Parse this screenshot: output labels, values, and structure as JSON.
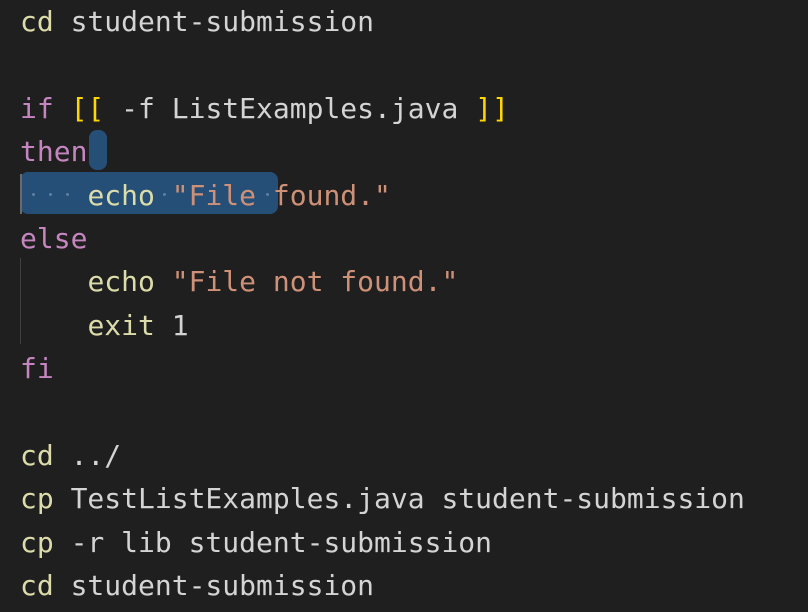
{
  "editor": {
    "lines": [
      {
        "tokens": [
          {
            "t": "cd",
            "c": "kw-cmd"
          },
          {
            "t": " student-submission",
            "c": "plain"
          }
        ]
      },
      {
        "tokens": []
      },
      {
        "tokens": [
          {
            "t": "if",
            "c": "kw-ctl"
          },
          {
            "t": " ",
            "c": "plain"
          },
          {
            "t": "[[",
            "c": "br1"
          },
          {
            "t": " -f ListExamples.java ",
            "c": "plain"
          },
          {
            "t": "]]",
            "c": "br1"
          }
        ]
      },
      {
        "tokens": [
          {
            "t": "then",
            "c": "kw-ctl"
          }
        ]
      },
      {
        "tokens": [
          {
            "t": "    ",
            "c": "plain"
          },
          {
            "t": "echo",
            "c": "kw-cmd"
          },
          {
            "t": " ",
            "c": "plain"
          },
          {
            "t": "\"File found.\"",
            "c": "str"
          }
        ]
      },
      {
        "tokens": [
          {
            "t": "else",
            "c": "kw-ctl"
          }
        ]
      },
      {
        "tokens": [
          {
            "t": "    ",
            "c": "plain"
          },
          {
            "t": "echo",
            "c": "kw-cmd"
          },
          {
            "t": " ",
            "c": "plain"
          },
          {
            "t": "\"File not found.\"",
            "c": "str"
          }
        ]
      },
      {
        "tokens": [
          {
            "t": "    ",
            "c": "plain"
          },
          {
            "t": "exit",
            "c": "kw-cmd"
          },
          {
            "t": " 1",
            "c": "num"
          }
        ]
      },
      {
        "tokens": [
          {
            "t": "fi",
            "c": "kw-ctl"
          }
        ]
      },
      {
        "tokens": []
      },
      {
        "tokens": [
          {
            "t": "cd",
            "c": "kw-cmd"
          },
          {
            "t": " ../",
            "c": "plain"
          }
        ]
      },
      {
        "tokens": [
          {
            "t": "cp",
            "c": "kw-cmd"
          },
          {
            "t": " TestListExamples.java student-submission",
            "c": "plain"
          }
        ]
      },
      {
        "tokens": [
          {
            "t": "cp",
            "c": "kw-cmd"
          },
          {
            "t": " -r lib student-submission",
            "c": "plain"
          }
        ]
      },
      {
        "tokens": [
          {
            "t": "cd",
            "c": "kw-cmd"
          },
          {
            "t": " student-submission",
            "c": "plain"
          }
        ]
      }
    ],
    "colors": {
      "background": "#1f1f1f",
      "selection": "#264f78",
      "command": "#dcdcaa",
      "control": "#c586c0",
      "string": "#ce9178",
      "bracket_outer": "#ffd700"
    }
  }
}
